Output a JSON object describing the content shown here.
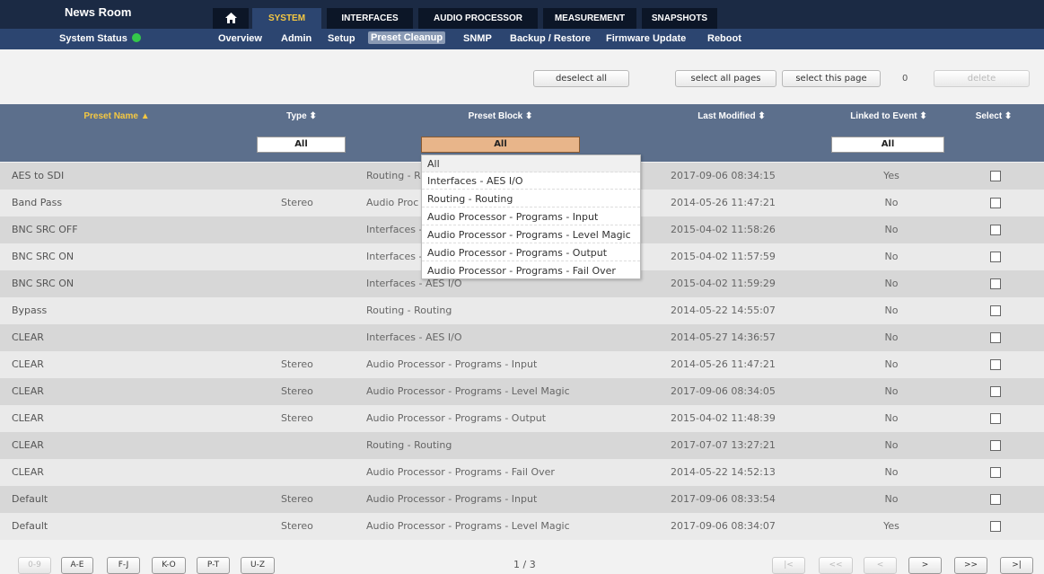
{
  "header": {
    "brand": "News Room",
    "tabs": [
      {
        "label": "SYSTEM",
        "active": true
      },
      {
        "label": "INTERFACES"
      },
      {
        "label": "AUDIO PROCESSOR"
      },
      {
        "label": "MEASUREMENT"
      },
      {
        "label": "SNAPSHOTS"
      }
    ],
    "home_icon": "home-icon",
    "status_label": "System Status",
    "status_color": "#34c84a",
    "subnav": [
      {
        "label": "Overview"
      },
      {
        "label": "Admin"
      },
      {
        "label": "Setup"
      },
      {
        "label": "Preset Cleanup",
        "active": true
      },
      {
        "label": "SNMP"
      },
      {
        "label": "Backup / Restore"
      },
      {
        "label": "Firmware Update"
      },
      {
        "label": "Reboot"
      }
    ]
  },
  "actions": {
    "deselect_all": "deselect all",
    "select_all_pages": "select all pages",
    "select_this_page": "select this page",
    "selected_count": "0",
    "delete": "delete"
  },
  "table": {
    "columns": {
      "name": "Preset Name ▲",
      "type": "Type ⬍",
      "block": "Preset Block ⬍",
      "modified": "Last Modified ⬍",
      "linked": "Linked to Event ⬍",
      "select": "Select ⬍"
    },
    "filters": {
      "type": "All",
      "block": "All",
      "linked": "All"
    },
    "rows": [
      {
        "name": "AES to SDI",
        "type": "",
        "block": "Routing - Routing",
        "modified": "2017-09-06 08:34:15",
        "linked": "Yes"
      },
      {
        "name": "Band Pass",
        "type": "Stereo",
        "block": "Audio Processor - Programs - Input",
        "modified": "2014-05-26 11:47:21",
        "linked": "No"
      },
      {
        "name": "BNC SRC OFF",
        "type": "",
        "block": "Interfaces - AES I/O",
        "modified": "2015-04-02 11:58:26",
        "linked": "No"
      },
      {
        "name": "BNC SRC ON",
        "type": "",
        "block": "Interfaces - AES I/O",
        "modified": "2015-04-02 11:57:59",
        "linked": "No"
      },
      {
        "name": "BNC SRC ON",
        "type": "",
        "block": "Interfaces - AES I/O",
        "modified": "2015-04-02 11:59:29",
        "linked": "No"
      },
      {
        "name": "Bypass",
        "type": "",
        "block": "Routing - Routing",
        "modified": "2014-05-22 14:55:07",
        "linked": "No"
      },
      {
        "name": "CLEAR",
        "type": "",
        "block": "Interfaces - AES I/O",
        "modified": "2014-05-27 14:36:57",
        "linked": "No"
      },
      {
        "name": "CLEAR",
        "type": "Stereo",
        "block": "Audio Processor - Programs - Input",
        "modified": "2014-05-26 11:47:21",
        "linked": "No"
      },
      {
        "name": "CLEAR",
        "type": "Stereo",
        "block": "Audio Processor - Programs - Level Magic",
        "modified": "2017-09-06 08:34:05",
        "linked": "No"
      },
      {
        "name": "CLEAR",
        "type": "Stereo",
        "block": "Audio Processor - Programs - Output",
        "modified": "2015-04-02 11:48:39",
        "linked": "No"
      },
      {
        "name": "CLEAR",
        "type": "",
        "block": "Routing - Routing",
        "modified": "2017-07-07 13:27:21",
        "linked": "No"
      },
      {
        "name": "CLEAR",
        "type": "",
        "block": "Audio Processor - Programs - Fail Over",
        "modified": "2014-05-22 14:52:13",
        "linked": "No"
      },
      {
        "name": "Default",
        "type": "Stereo",
        "block": "Audio Processor - Programs - Input",
        "modified": "2017-09-06 08:33:54",
        "linked": "No"
      },
      {
        "name": "Default",
        "type": "Stereo",
        "block": "Audio Processor - Programs - Level Magic",
        "modified": "2017-09-06 08:34:07",
        "linked": "Yes"
      }
    ],
    "row_block_visible": [
      "Routing - Ro",
      "Audio Proc",
      "Interfaces -",
      "Interfaces -"
    ]
  },
  "dropdown": {
    "options": [
      "All",
      "Interfaces - AES I/O",
      "Routing - Routing",
      "Audio Processor - Programs - Input",
      "Audio Processor - Programs - Level Magic",
      "Audio Processor - Programs - Output",
      "Audio Processor - Programs - Fail Over"
    ]
  },
  "pager": {
    "letters": [
      "0-9",
      "A-E",
      "F-J",
      "K-O",
      "P-T",
      "U-Z"
    ],
    "page": "1 / 3",
    "nav": [
      "|<",
      "<<",
      "<",
      ">",
      ">>",
      ">|"
    ]
  }
}
